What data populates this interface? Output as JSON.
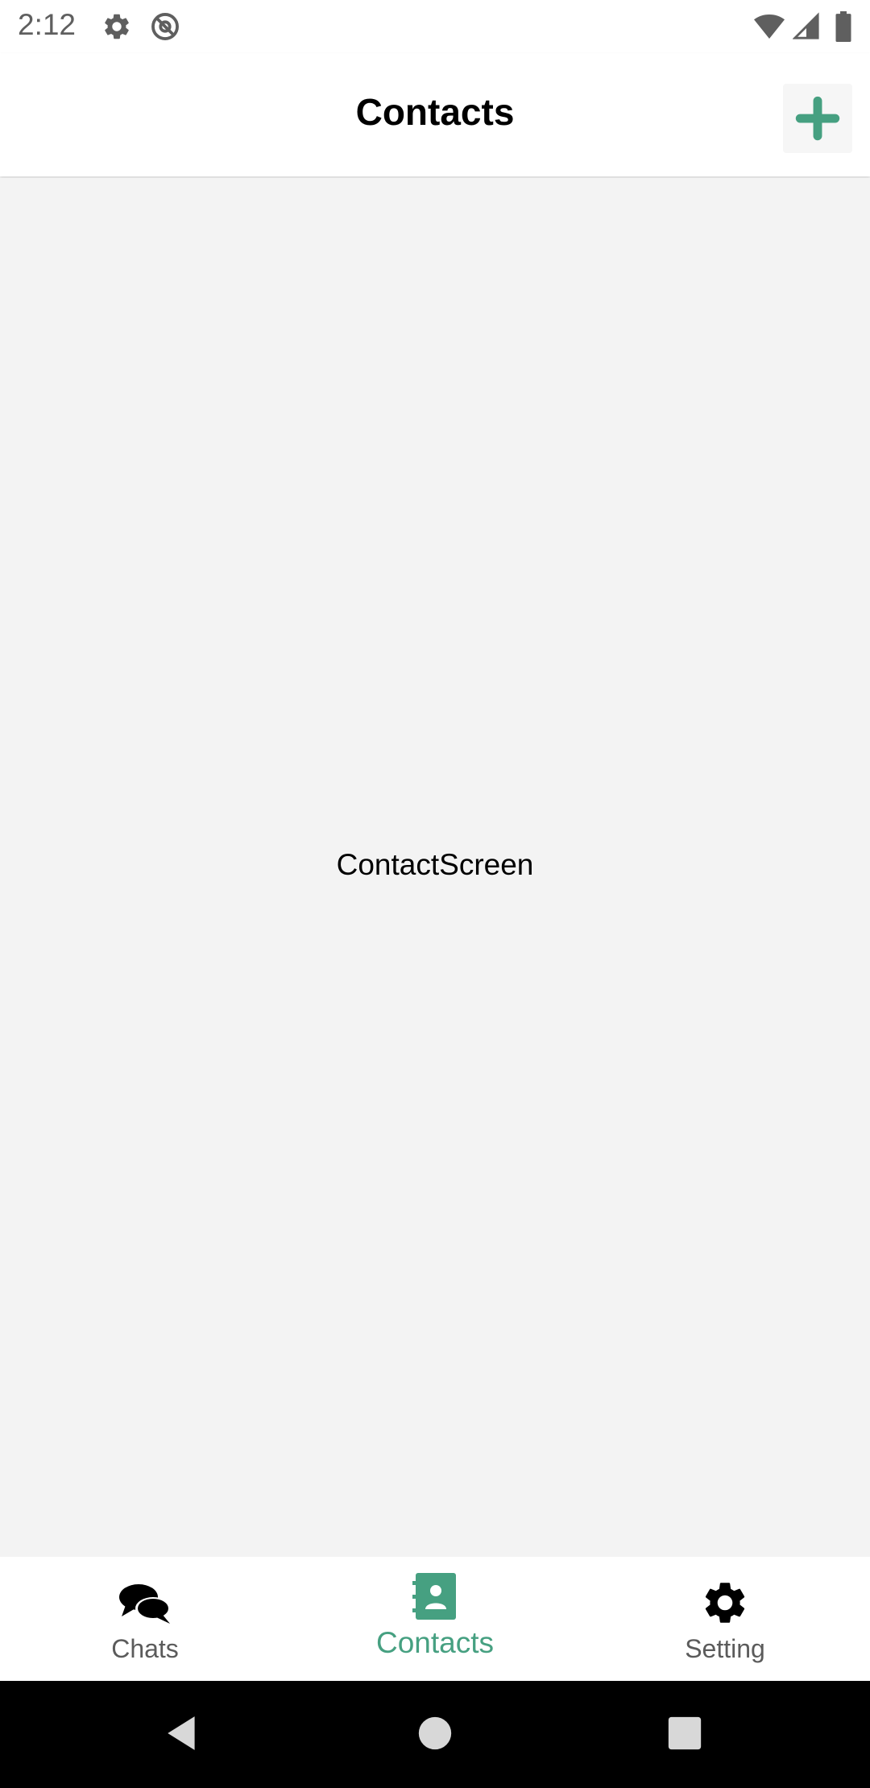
{
  "status_bar": {
    "time": "2:12",
    "icons": [
      "gear-icon",
      "at-sign-icon",
      "wifi-icon",
      "signal-icon",
      "battery-icon"
    ]
  },
  "header": {
    "title": "Contacts",
    "add_icon": "plus-icon"
  },
  "main": {
    "placeholder_text": "ContactScreen"
  },
  "bottom_nav": {
    "items": [
      {
        "label": "Chats",
        "icon": "chat-bubbles-icon",
        "active": false
      },
      {
        "label": "Contacts",
        "icon": "contact-book-icon",
        "active": true
      },
      {
        "label": "Setting",
        "icon": "gear-icon",
        "active": false
      }
    ]
  },
  "system_nav": {
    "buttons": [
      "back-icon",
      "home-icon",
      "recents-icon"
    ]
  },
  "colors": {
    "accent": "#46a081",
    "background": "#f3f3f3",
    "inactive": "#5b5b5b"
  }
}
